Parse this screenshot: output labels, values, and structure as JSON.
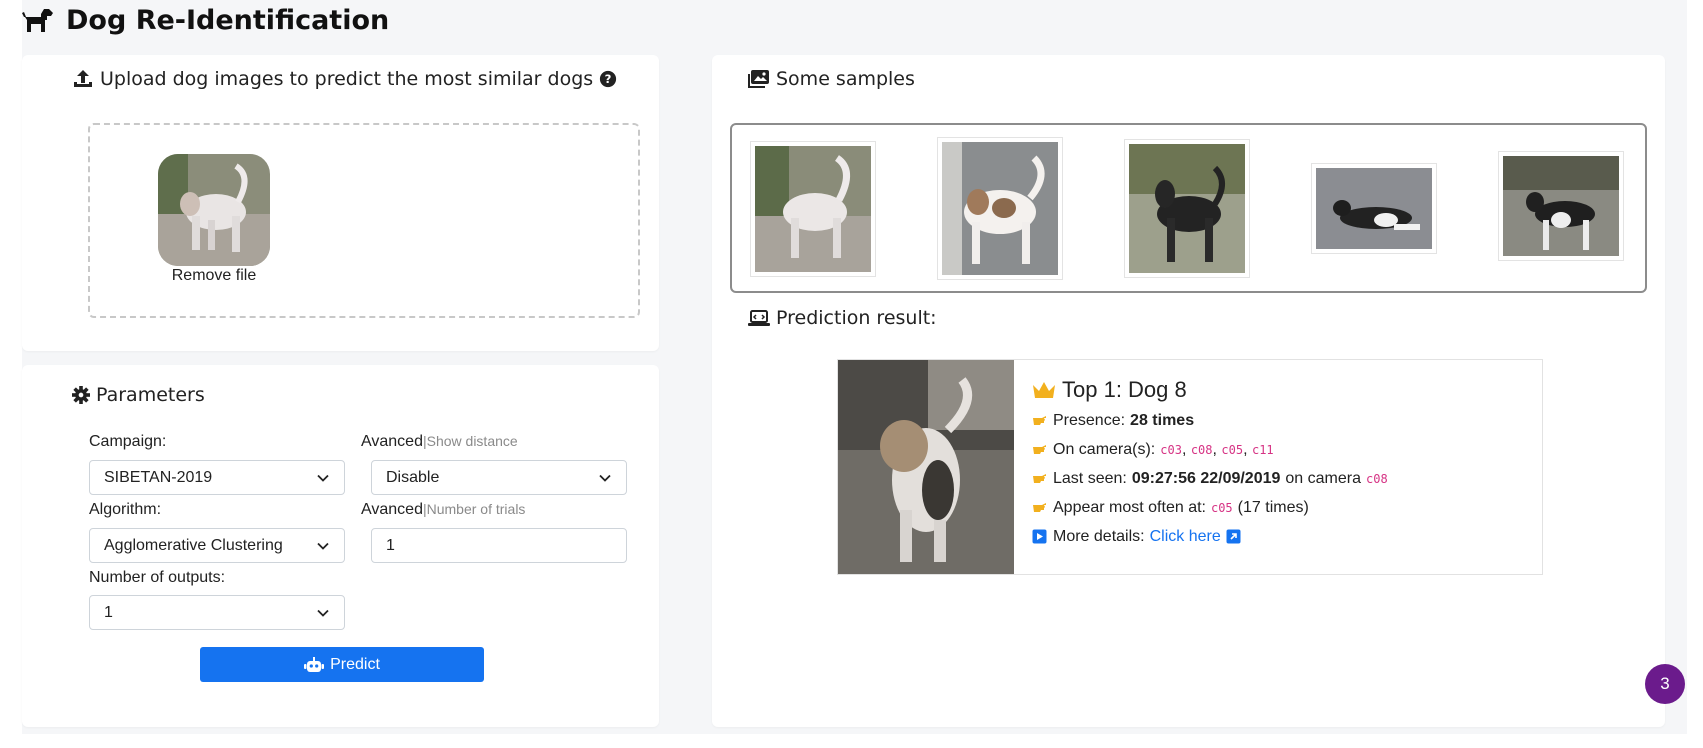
{
  "page": {
    "title": "Dog Re-Identification"
  },
  "upload": {
    "title": "Upload dog images to predict the most similar dogs",
    "remove_label": "Remove file"
  },
  "params": {
    "title": "Parameters",
    "campaign": {
      "label": "Campaign:",
      "value": "SIBETAN-2019"
    },
    "algorithm": {
      "label": "Algorithm:",
      "value": "Agglomerative Clustering"
    },
    "outputs": {
      "label": "Number of outputs:",
      "value": "1"
    },
    "distance": {
      "label": "Avanced",
      "sub": "|Show distance",
      "value": "Disable"
    },
    "trials": {
      "label": "Avanced",
      "sub": "|Number of trials",
      "value": "1"
    },
    "predict_label": "Predict"
  },
  "samples": {
    "title": "Some samples"
  },
  "prediction": {
    "title": "Prediction result:",
    "top": "Top 1: Dog 8",
    "presence": {
      "label": "Presence:",
      "value": "28 times"
    },
    "cameras": {
      "label": "On camera(s):",
      "values": [
        "c03",
        "c08",
        "c05",
        "c11"
      ]
    },
    "last_seen": {
      "label": "Last seen:",
      "value": "09:27:56 22/09/2019",
      "mid": "on camera",
      "camera": "c08"
    },
    "most_often": {
      "label": "Appear most often at:",
      "camera": "c05",
      "count": "(17 times)"
    },
    "details": {
      "label": "More details:",
      "link": "Click here"
    }
  },
  "badge": {
    "count": "3"
  },
  "colors": {
    "primary": "#1573f0",
    "code": "#d63384",
    "crown": "#f2b01e",
    "badge": "#6b1b8c"
  }
}
